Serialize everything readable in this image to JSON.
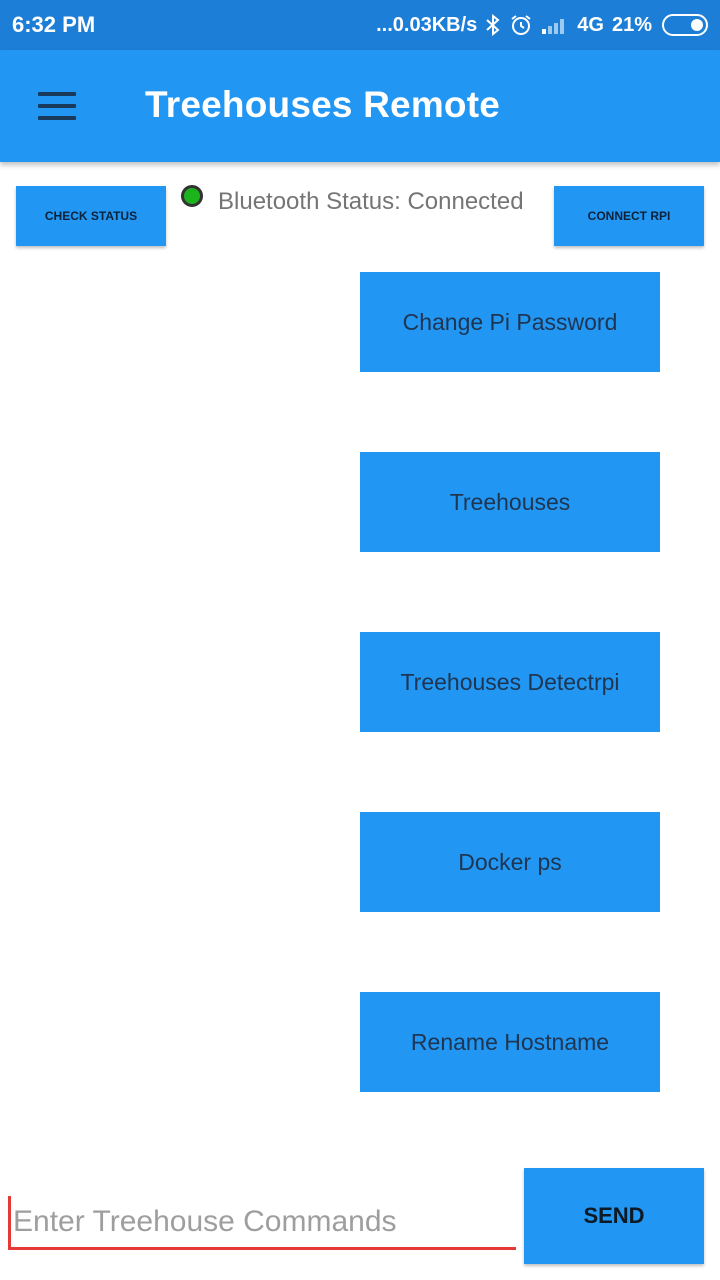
{
  "status_bar": {
    "time": "6:32 PM",
    "network_speed": "...0.03KB/s",
    "network_type": "4G",
    "battery": "21%",
    "icons": [
      "bluetooth-icon",
      "alarm-icon",
      "signal-icon",
      "battery-icon"
    ]
  },
  "app_bar": {
    "title": "Treehouses Remote",
    "menu_icon": "menu-icon"
  },
  "top_controls": {
    "check_status_label": "CHECK STATUS",
    "connect_label": "CONNECT RPI",
    "bluetooth_status": "Bluetooth Status: Connected",
    "status_color": "#1db31d"
  },
  "commands": [
    {
      "label": "Change Pi Password"
    },
    {
      "label": "Treehouses"
    },
    {
      "label": "Treehouses Detectrpi"
    },
    {
      "label": "Docker ps"
    },
    {
      "label": "Rename Hostname"
    }
  ],
  "command_input": {
    "placeholder": "Enter Treehouse Commands",
    "value": ""
  },
  "send_label": "SEND",
  "colors": {
    "primary": "#2196f3",
    "status_bar": "#1c7ed6",
    "input_underline": "#e53935"
  }
}
